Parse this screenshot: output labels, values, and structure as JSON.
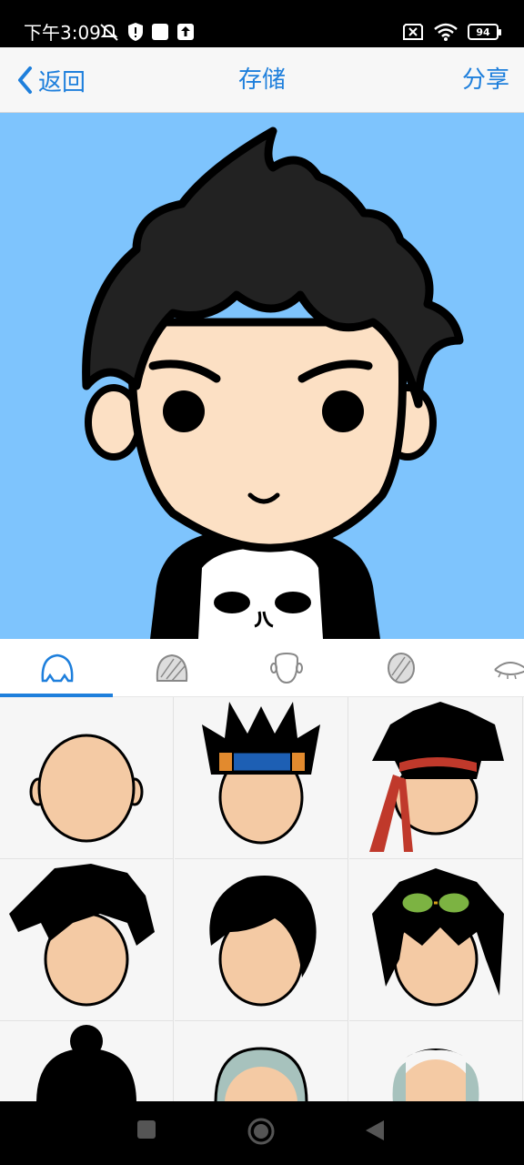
{
  "status_bar": {
    "time": "下午3:09",
    "battery": "94"
  },
  "nav": {
    "back_label": "返回",
    "title": "存储",
    "share_label": "分享"
  },
  "tabs": [
    {
      "icon": "hair-outline-icon",
      "active": true
    },
    {
      "icon": "hair-striped-icon",
      "active": false
    },
    {
      "icon": "face-shape-icon",
      "active": false
    },
    {
      "icon": "face-striped-icon",
      "active": false
    },
    {
      "icon": "eyes-icon",
      "active": false
    }
  ],
  "hairstyles": [
    "bald-option",
    "ninja-headband-hair",
    "red-bandana-hair",
    "messy-black-hair",
    "side-part-hair",
    "green-goggles-hair",
    "bun-hair",
    "gray-hair",
    "balding-gray-hair"
  ],
  "colors": {
    "accent": "#1e7fdc",
    "canvas_bg": "#7ec4fd",
    "skin": "#fce0c4",
    "hair": "#222222"
  }
}
